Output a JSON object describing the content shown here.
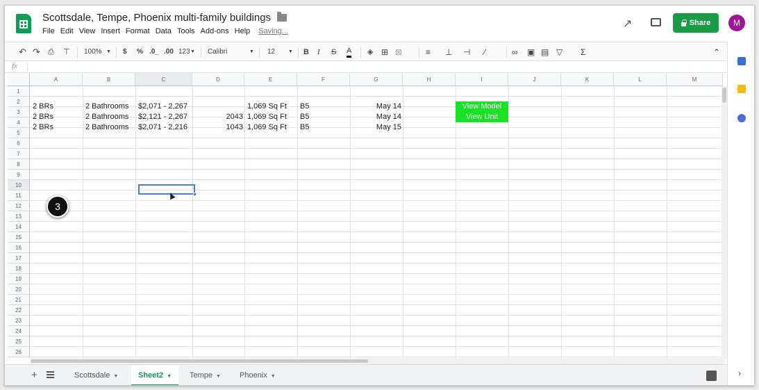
{
  "doc": {
    "title": "Scottsdale, Tempe, Phoenix multi-family buildings",
    "status": "Saving...",
    "share_label": "Share",
    "avatar_letter": "M"
  },
  "menu": [
    "File",
    "Edit",
    "View",
    "Insert",
    "Format",
    "Data",
    "Tools",
    "Add-ons",
    "Help"
  ],
  "toolbar": {
    "zoom": "100%",
    "currency": "$",
    "percent": "%",
    "dec_less": ".0_",
    "dec_more": ".00",
    "format_more": "123",
    "font": "Calibri",
    "font_size": "12",
    "bold": "B",
    "italic": "I",
    "strike": "S",
    "text_color": "A",
    "sum": "Σ"
  },
  "formula_bar": {
    "fx_label": "fx",
    "value": ""
  },
  "columns": [
    "A",
    "B",
    "C",
    "D",
    "E",
    "F",
    "G",
    "H",
    "I",
    "J",
    "K",
    "L",
    "M"
  ],
  "selected_column": "C",
  "rows": [
    "1",
    "2",
    "3",
    "4",
    "5",
    "6",
    "7",
    "8",
    "9",
    "10",
    "11",
    "12",
    "13",
    "14",
    "15",
    "16",
    "17",
    "18",
    "19",
    "20",
    "21",
    "22",
    "23",
    "24",
    "25",
    "26"
  ],
  "selected_row": "10",
  "cells": {
    "r2": {
      "A": "2 BRs",
      "B": "2 Bathrooms",
      "C": "$2,071 - 2,267",
      "D": "",
      "E": "1,069 Sq Ft",
      "F": "B5",
      "G": "May 14"
    },
    "r3": {
      "A": "2 BRs",
      "B": "2 Bathrooms",
      "C": "$2,121 - 2,267",
      "D": "2043",
      "E": "1,069 Sq Ft",
      "F": "B5",
      "G": "May 14"
    },
    "r4": {
      "A": "2 BRs",
      "B": "2 Bathrooms",
      "C": "$2,071 - 2,216",
      "D": "1043",
      "E": "1,069 Sq Ft",
      "F": "B5",
      "G": "May 15"
    }
  },
  "cell_buttons": {
    "view_model": "View Model",
    "view_unit": "View Unit",
    "color": "#18e225"
  },
  "step_marker": "3",
  "sheets": [
    {
      "name": "Scottsdale",
      "active": false
    },
    {
      "name": "Sheet2",
      "active": true
    },
    {
      "name": "Tempe",
      "active": false
    },
    {
      "name": "Phoenix",
      "active": false
    }
  ],
  "colors": {
    "brand_green": "#0f9d58",
    "share_green": "#1a9b45",
    "selection_blue": "#4a7fd6",
    "avatar": "#a0149a"
  },
  "icons": [
    "sheets-logo-icon",
    "star-icon",
    "folder-icon",
    "trend-icon",
    "comment-icon",
    "lock-icon",
    "undo-icon",
    "redo-icon",
    "print-icon",
    "paint-format-icon",
    "fill-color-icon",
    "borders-icon",
    "merge-icon",
    "align-icon",
    "valign-icon",
    "wrap-icon",
    "rotate-icon",
    "link-icon",
    "insert-comment-icon",
    "chart-icon",
    "filter-icon",
    "collapse-icon",
    "add-sheet-icon",
    "all-sheets-icon",
    "explore-icon",
    "calendar-icon",
    "keep-icon",
    "tasks-icon",
    "chevron-right-icon"
  ]
}
